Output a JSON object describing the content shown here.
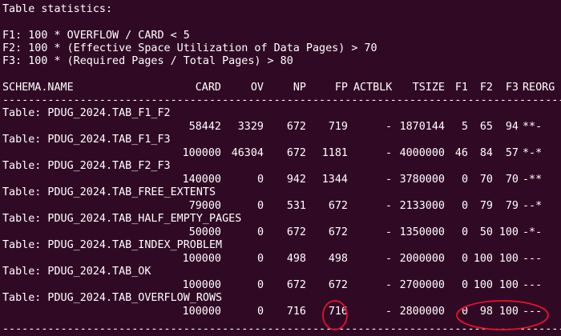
{
  "terminal": {
    "title": "Table statistics:",
    "formulas": [
      "F1: 100 * OVERFLOW / CARD < 5",
      "F2: 100 * (Effective Space Utilization of Data Pages) > 70",
      "F3: 100 * (Required Pages / Total Pages) > 80"
    ],
    "headers": [
      "SCHEMA.NAME",
      "CARD",
      "OV",
      "NP",
      "FP",
      "ACTBLK",
      "TSIZE",
      "F1",
      "F2",
      "F3",
      "REORG"
    ],
    "separator": "-----------------------------------------------------------------------------------------",
    "tables": [
      {
        "name": "Table: PDUG_2024.TAB_F1_F2",
        "values": [
          "58442",
          "3329",
          "672",
          "719",
          "-",
          "1870144",
          "5",
          "65",
          "94",
          "**-"
        ]
      },
      {
        "name": "Table: PDUG_2024.TAB_F1_F3",
        "values": [
          "100000",
          "46304",
          "672",
          "1181",
          "-",
          "4000000",
          "46",
          "84",
          "57",
          "*-*"
        ]
      },
      {
        "name": "Table: PDUG_2024.TAB_F2_F3",
        "values": [
          "140000",
          "0",
          "942",
          "1344",
          "-",
          "3780000",
          "0",
          "70",
          "70",
          "-**"
        ]
      },
      {
        "name": "Table: PDUG_2024.TAB_FREE_EXTENTS",
        "values": [
          "79000",
          "0",
          "531",
          "672",
          "-",
          "2133000",
          "0",
          "79",
          "79",
          "--*"
        ]
      },
      {
        "name": "Table: PDUG_2024.TAB_HALF_EMPTY_PAGES",
        "values": [
          "50000",
          "0",
          "672",
          "672",
          "-",
          "1350000",
          "0",
          "50",
          "100",
          "-*-"
        ]
      },
      {
        "name": "Table: PDUG_2024.TAB_INDEX_PROBLEM",
        "values": [
          "100000",
          "0",
          "498",
          "498",
          "-",
          "2000000",
          "0",
          "100",
          "100",
          "---"
        ]
      },
      {
        "name": "Table: PDUG_2024.TAB_OK",
        "values": [
          "100000",
          "0",
          "672",
          "672",
          "-",
          "2700000",
          "0",
          "100",
          "100",
          "---"
        ]
      },
      {
        "name": "Table: PDUG_2024.TAB_OVERFLOW_ROWS",
        "values": [
          "100000",
          "0",
          "716",
          "716",
          "-",
          "2800000",
          "0",
          "98",
          "100",
          "---"
        ]
      }
    ]
  },
  "colors": {
    "background": "#300a24",
    "text": "#ffffff",
    "annotation": "#e8102a"
  }
}
